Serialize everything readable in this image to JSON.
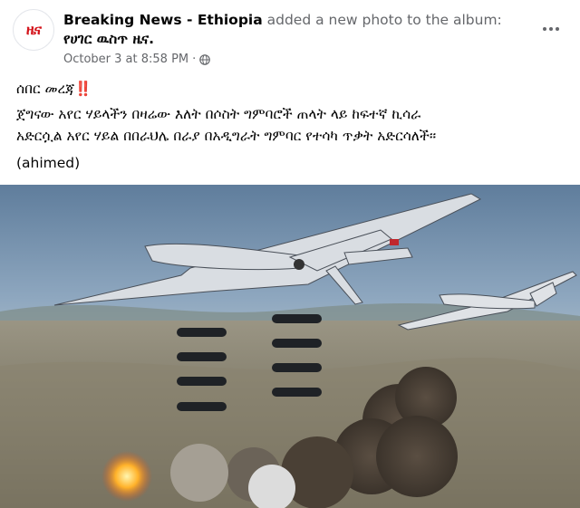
{
  "post": {
    "avatar_text": "ዜና",
    "page_name": "Breaking News - Ethiopia",
    "action_text": " added a new photo to the album: ",
    "album_name": "የሀገር ዉስጥ ዜና.",
    "timestamp": "October 3 at 8:58 PM",
    "separator": "·",
    "headline": "ሰበር መረጃ",
    "headline_emoji": "‼️",
    "body_line1": "ጀግናው አየር ሃይላችን በዛሬው እለት በሶስት ግምባሮች ጠላት ላይ ከፍተኛ ኪሳራ",
    "body_line2": "አድርሷል አየር ሃይል በበራህሌ በራያ በአዲግራት ግምባር የተሳካ ጥቃት አድርሳለች፡፡",
    "credit": "(ahimed)"
  },
  "icons": {
    "globe": "globe-icon",
    "more": "more-options-icon"
  },
  "colors": {
    "brand_red": "#d4151c",
    "meta_gray": "#65676b",
    "text": "#050505"
  }
}
